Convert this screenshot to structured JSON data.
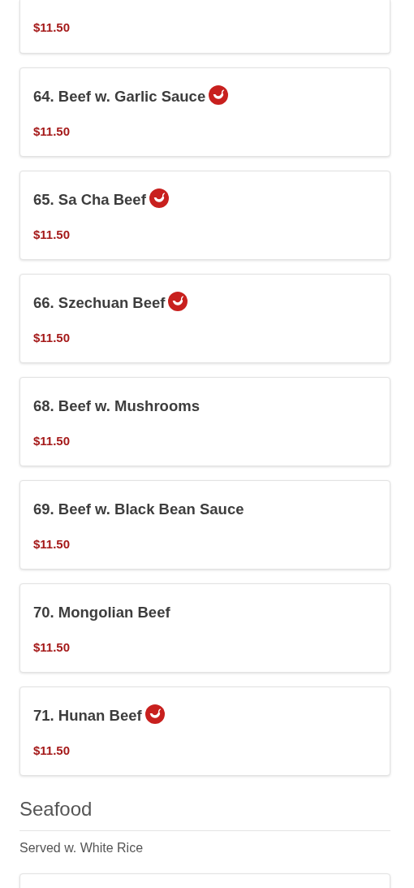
{
  "sections": [
    {
      "items": [
        {
          "price": "$11.50"
        },
        {
          "name": "64. Beef w. Garlic Sauce",
          "price": "$11.50",
          "spicy": true
        },
        {
          "name": "65. Sa Cha Beef",
          "price": "$11.50",
          "spicy": true
        },
        {
          "name": "66. Szechuan Beef",
          "price": "$11.50",
          "spicy": true
        },
        {
          "name": "68. Beef w. Mushrooms",
          "price": "$11.50",
          "spicy": false
        },
        {
          "name": "69. Beef w. Black Bean Sauce",
          "price": "$11.50",
          "spicy": false
        },
        {
          "name": "70. Mongolian Beef",
          "price": "$11.50",
          "spicy": false
        },
        {
          "name": "71. Hunan Beef",
          "price": "$11.50",
          "spicy": true
        }
      ]
    },
    {
      "title": "Seafood",
      "note": "Served w. White Rice",
      "items": [
        {
          "kind": "partial"
        }
      ]
    }
  ]
}
